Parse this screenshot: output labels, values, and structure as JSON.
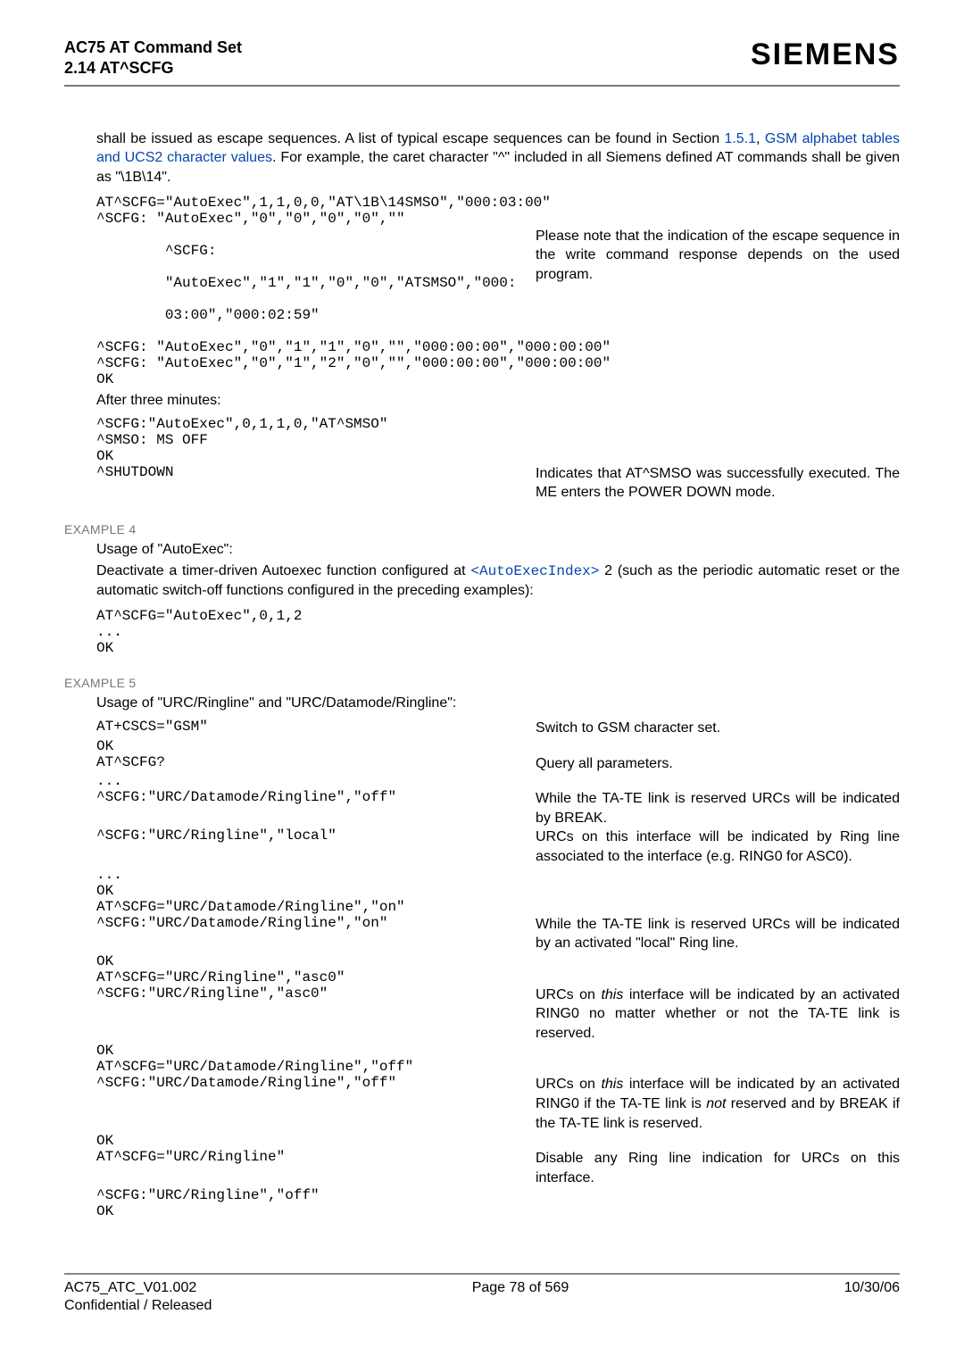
{
  "header": {
    "title": "AC75 AT Command Set",
    "subtitle": "2.14 AT^SCFG",
    "brand": "SIEMENS"
  },
  "intro": {
    "text_before_link": "shall be issued as escape sequences. A list of typical escape sequences can be found in Section ",
    "link1": "1.5.1",
    "comma": ", ",
    "link2": "GSM alphabet tables and UCS2 character values",
    "text_after_link": ". For example, the caret character \"^\" included in all Siemens defined AT commands shall be given as \"\\1B\\14\"."
  },
  "block_top": {
    "l1": "AT^SCFG=\"AutoExec\",1,1,0,0,\"AT\\1B\\14SMSO\",\"000:03:00\"",
    "l2": "^SCFG: \"AutoExec\",\"0\",\"0\",\"0\",\"0\",\"\"",
    "l3a": "^SCFG: ",
    "l3b": "\"AutoExec\",\"1\",\"1\",\"0\",\"0\",\"ATSMSO\",\"000:",
    "l3c": "03:00\",\"000:02:59\"",
    "r3": "Please note that the indication of the escape sequence in the write command response depends on the used program.",
    "l4": "^SCFG: \"AutoExec\",\"0\",\"1\",\"1\",\"0\",\"\",\"000:00:00\",\"000:00:00\"",
    "l5": "^SCFG: \"AutoExec\",\"0\",\"1\",\"2\",\"0\",\"\",\"000:00:00\",\"000:00:00\"",
    "l6": "OK"
  },
  "after3": {
    "heading": "After three minutes:",
    "l1": "^SCFG:\"AutoExec\",0,1,1,0,\"AT^SMSO\"",
    "l2": "^SMSO: MS OFF",
    "l3": "OK",
    "l4": "^SHUTDOWN",
    "r4": "Indicates that AT^SMSO was successfully executed. The ME enters the POWER DOWN mode."
  },
  "ex4": {
    "label": "EXAMPLE 4",
    "title": "Usage of \"AutoExec\":",
    "desc_a": "Deactivate a timer-driven Autoexec function configured at ",
    "desc_token": "<AutoExecIndex>",
    "desc_b": " 2 (such as the periodic automatic reset or the automatic switch-off functions configured in the preceding examples):",
    "l1": "AT^SCFG=\"AutoExec\",0,1,2",
    "l2": "...",
    "l3": "OK"
  },
  "ex5": {
    "label": "EXAMPLE 5",
    "title": "Usage of \"URC/Ringline\" and \"URC/Datamode/Ringline\":",
    "rows": [
      {
        "code": "AT+CSCS=\"GSM\"",
        "note": "Switch to GSM character set."
      },
      {
        "code": "OK",
        "note": ""
      },
      {
        "code": "AT^SCFG?",
        "note": "Query all parameters."
      },
      {
        "code": "...",
        "note": ""
      },
      {
        "code": "^SCFG:\"URC/Datamode/Ringline\",\"off\"",
        "note": "While the TA-TE link is reserved URCs will be indicated by BREAK."
      },
      {
        "code": "^SCFG:\"URC/Ringline\",\"local\"",
        "note": "URCs on this interface will be indicated by Ring line associated to the interface (e.g. RING0 for ASC0)."
      },
      {
        "code": "...",
        "note": ""
      },
      {
        "code": "OK",
        "note": ""
      },
      {
        "code": "AT^SCFG=\"URC/Datamode/Ringline\",\"on\"",
        "note": ""
      },
      {
        "code": "^SCFG:\"URC/Datamode/Ringline\",\"on\"",
        "note": "While the TA-TE link is reserved URCs will be indicated by an activated \"local\" Ring line."
      },
      {
        "code": "OK",
        "note": ""
      },
      {
        "code": "AT^SCFG=\"URC/Ringline\",\"asc0\"",
        "note": ""
      },
      {
        "code": "^SCFG:\"URC/Ringline\",\"asc0\"",
        "note_html": "URCs on <i>this</i> interface will be indicated by an activated RING0 no matter whether or not the TA-TE link is reserved."
      },
      {
        "code": "OK",
        "note": ""
      },
      {
        "code": "AT^SCFG=\"URC/Datamode/Ringline\",\"off\"",
        "note": ""
      },
      {
        "code": "^SCFG:\"URC/Datamode/Ringline\",\"off\"",
        "note_html": "URCs on <i>this</i> interface will be indicated by an activated RING0 if the TA-TE link is <i>not</i> reserved and by BREAK if the TA-TE link is reserved."
      },
      {
        "code": "OK",
        "note": ""
      },
      {
        "code": "AT^SCFG=\"URC/Ringline\"",
        "note": "Disable any Ring line indication for URCs on this interface."
      },
      {
        "code": "^SCFG:\"URC/Ringline\",\"off\"",
        "note": ""
      },
      {
        "code": "OK",
        "note": ""
      }
    ]
  },
  "footer": {
    "left1": "AC75_ATC_V01.002",
    "left2": "Confidential / Released",
    "center": "Page 78 of 569",
    "right": "10/30/06"
  }
}
